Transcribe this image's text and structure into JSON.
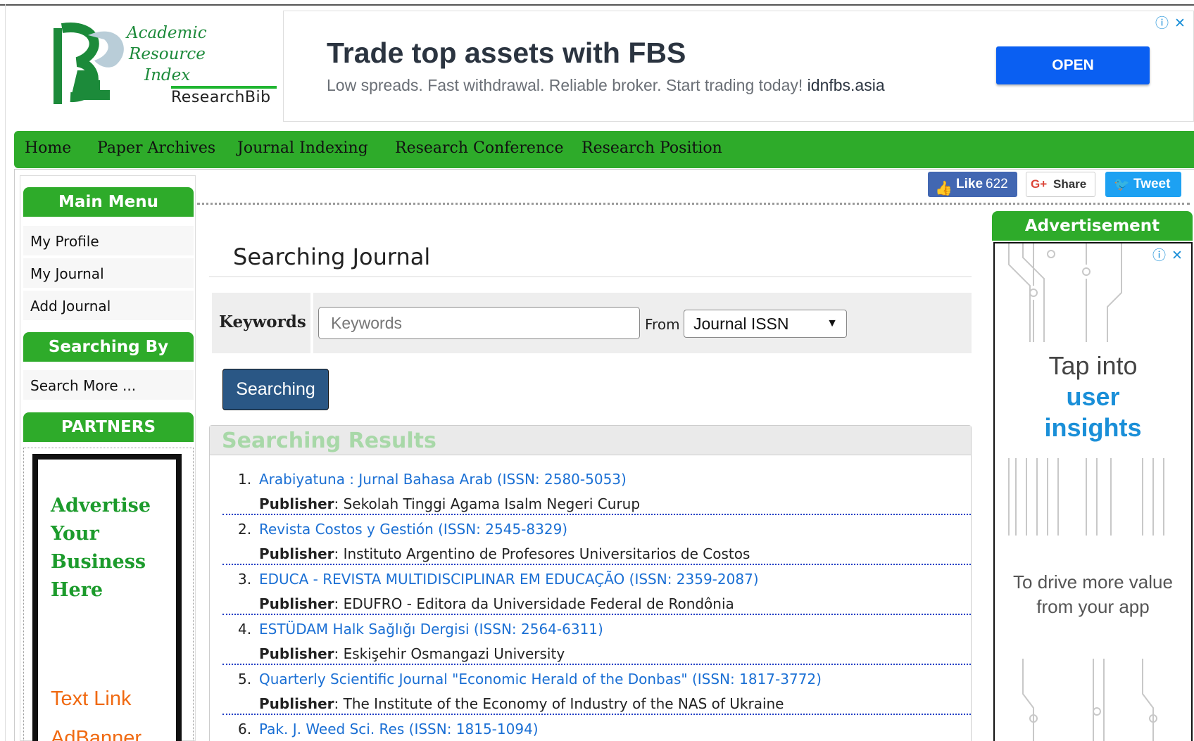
{
  "logo": {
    "line1": "Academic",
    "line2": "Resource",
    "line3": "Index",
    "brand": "ResearchBib"
  },
  "top_ad": {
    "headline": "Trade top assets with FBS",
    "sub": "Low spreads. Fast withdrawal. Reliable broker. Start trading today!",
    "domain": "idnfbs.asia",
    "button": "OPEN"
  },
  "nav": {
    "items": [
      "Home",
      "Paper Archives",
      "Journal Indexing",
      "Research Conference",
      "Research Position"
    ]
  },
  "social": {
    "like_label": "Like",
    "like_count": "622",
    "share_label": "Share",
    "tweet_label": "Tweet"
  },
  "sidebar": {
    "main_menu_title": "Main Menu",
    "menu_items": [
      "My Profile",
      "My Journal",
      "Add Journal"
    ],
    "searching_by_title": "Searching By",
    "search_more": "Search More ...",
    "partners_title": "PARTNERS",
    "partner_ad_lines": [
      "Advertise",
      "Your",
      "Business",
      "Here"
    ],
    "partner_links": [
      "Text Link",
      "AdBanner"
    ]
  },
  "main": {
    "title": "Searching Journal",
    "keywords_label": "Keywords",
    "keywords_placeholder": "Keywords",
    "keywords_value": "",
    "from_label": "From",
    "from_selected": "Journal ISSN",
    "search_button": "Searching",
    "results_title": "Searching Results",
    "publisher_label": "Publisher",
    "results": [
      {
        "num": "1.",
        "title": "Arabiyatuna : Jurnal Bahasa Arab (ISSN: 2580-5053)",
        "publisher": "Sekolah Tinggi Agama Isalm Negeri Curup"
      },
      {
        "num": "2.",
        "title": "Revista Costos y Gestión (ISSN: 2545-8329)",
        "publisher": "Instituto Argentino de Profesores Universitarios de Costos"
      },
      {
        "num": "3.",
        "title": "EDUCA - REVISTA MULTIDISCIPLINAR EM EDUCAÇÃO (ISSN: 2359-2087)",
        "publisher": "EDUFRO - Editora da Universidade Federal de Rondônia"
      },
      {
        "num": "4.",
        "title": "ESTÜDAM Halk Sağlığı Dergisi (ISSN: 2564-6311)",
        "publisher": "Eskişehir Osmangazi University"
      },
      {
        "num": "5.",
        "title": "Quarterly Scientific Journal \"Economic Herald of the Donbas\" (ISSN: 1817-3772)",
        "publisher": "The Institute of the Economy of Industry of the NAS of Ukraine"
      },
      {
        "num": "6.",
        "title": "Pak. J. Weed Sci. Res (ISSN: 1815-1094)",
        "publisher": ""
      }
    ]
  },
  "right_ad": {
    "title": "Advertisement",
    "tap_line1": "Tap into",
    "tap_line2": "user",
    "tap_line3": "insights",
    "drive": "To drive more value from your app"
  },
  "icons": {
    "adchoices": "info-icon",
    "close": "close-icon",
    "fb": "thumbs-up-icon",
    "gplus": "google-plus-icon",
    "twitter": "twitter-bird-icon"
  }
}
